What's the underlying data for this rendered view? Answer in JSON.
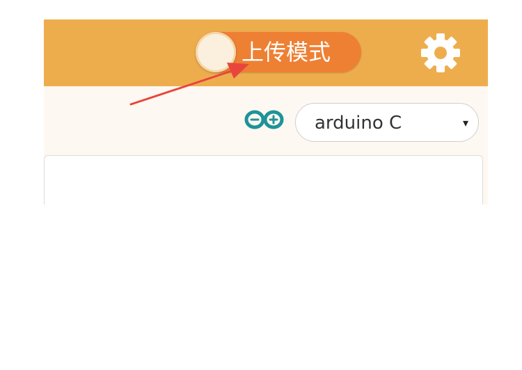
{
  "header": {
    "mode_toggle": {
      "label": "上传模式",
      "state": "off"
    },
    "settings": {
      "icon": "gear-icon"
    }
  },
  "toolbar": {
    "logo": {
      "icon": "arduino-logo-icon"
    },
    "language_select": {
      "value": "arduino C",
      "caret": "▾"
    }
  },
  "annotation": {
    "arrow": "red-arrow",
    "color": "#e8463c"
  },
  "colors": {
    "header_bg": "#eead4d",
    "toggle_bg": "#ee8034",
    "toolbar_bg": "#fdf8f1",
    "logo": "#1e9399"
  }
}
